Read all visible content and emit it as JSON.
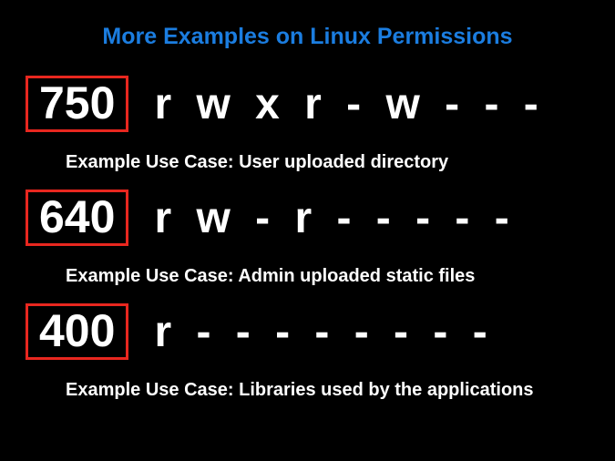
{
  "title": "More Examples on Linux Permissions",
  "examples": [
    {
      "octal": "750",
      "symbolic": "r w x r - w - - -",
      "use_case": "Example Use Case: User uploaded directory"
    },
    {
      "octal": "640",
      "symbolic": "r w - r - - - - -",
      "use_case": "Example Use Case: Admin uploaded static files"
    },
    {
      "octal": "400",
      "symbolic": "r - - - - - - - -",
      "use_case": "Example Use Case: Libraries used by the applications"
    }
  ]
}
